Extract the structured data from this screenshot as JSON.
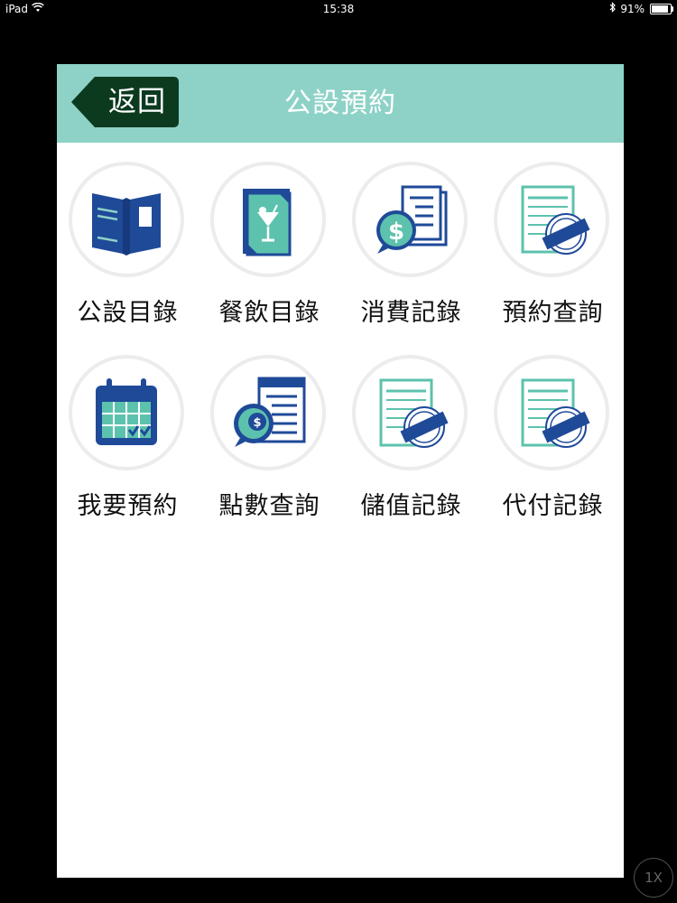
{
  "status_bar": {
    "device": "iPad",
    "time": "15:38",
    "battery": "91%",
    "battery_level": 0.91
  },
  "header": {
    "back_label": "返回",
    "title": "公設預約"
  },
  "menu": [
    {
      "label": "公設目錄",
      "icon": "open-book-icon"
    },
    {
      "label": "餐飲目錄",
      "icon": "drink-menu-icon"
    },
    {
      "label": "消費記錄",
      "icon": "dollar-receipt-icon"
    },
    {
      "label": "預約查詢",
      "icon": "stamped-document-icon"
    },
    {
      "label": "我要預約",
      "icon": "calendar-check-icon"
    },
    {
      "label": "點數查詢",
      "icon": "coin-receipt-icon"
    },
    {
      "label": "儲值記錄",
      "icon": "stamped-document-icon"
    },
    {
      "label": "代付記錄",
      "icon": "stamped-document-icon"
    }
  ],
  "colors": {
    "header_bg": "#8ed2c7",
    "back_button_bg": "#0c3a1f",
    "icon_navy": "#1f4a98",
    "icon_teal": "#5cc2ad"
  },
  "speed_indicator": "1X"
}
